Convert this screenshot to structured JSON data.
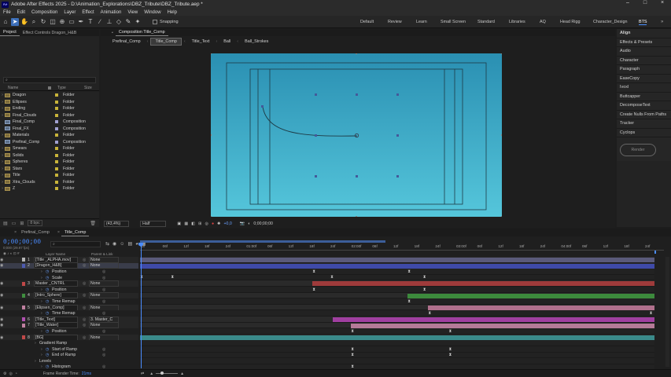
{
  "app": {
    "title": "Adobe After Effects 2025 - D:\\Animation_Explorations\\DBZ_Tribute\\DBZ_Tribute.aep *",
    "logo_text": "Ae"
  },
  "menu": [
    "File",
    "Edit",
    "Composition",
    "Layer",
    "Effect",
    "Animation",
    "View",
    "Window",
    "Help"
  ],
  "toolbar": {
    "snapping_label": "Snapping",
    "workspaces": [
      "Default",
      "Review",
      "Learn",
      "Small Screen",
      "Standard",
      "Libraries",
      "AQ",
      "Head Rigg",
      "Character_Design",
      "BTS"
    ],
    "active_workspace": "BTS"
  },
  "project_panel": {
    "tab_project": "Project",
    "tab_effect_controls": "Effect Controls Dragon_H&B",
    "search_placeholder": "",
    "col_name": "Name",
    "col_type": "Type",
    "col_size": "Size",
    "items": [
      {
        "name": "Dragon",
        "type": "Folder",
        "kind": "folder"
      },
      {
        "name": "Ellipses",
        "type": "Folder",
        "kind": "folder"
      },
      {
        "name": "Ending",
        "type": "Folder",
        "kind": "folder"
      },
      {
        "name": "Final_Clouds",
        "type": "Folder",
        "kind": "folder"
      },
      {
        "name": "Final_Comp",
        "type": "Composition",
        "kind": "comp"
      },
      {
        "name": "Final_FX",
        "type": "Composition",
        "kind": "comp"
      },
      {
        "name": "Materials",
        "type": "Folder",
        "kind": "folder"
      },
      {
        "name": "Prefinal_Comp",
        "type": "Composition",
        "kind": "comp"
      },
      {
        "name": "Smears",
        "type": "Folder",
        "kind": "folder"
      },
      {
        "name": "Solids",
        "type": "Folder",
        "kind": "folder"
      },
      {
        "name": "Spheres",
        "type": "Folder",
        "kind": "folder"
      },
      {
        "name": "Stars",
        "type": "Folder",
        "kind": "folder"
      },
      {
        "name": "Title",
        "type": "Folder",
        "kind": "folder"
      },
      {
        "name": "Xtra_Clouds",
        "type": "Folder",
        "kind": "folder"
      },
      {
        "name": "Z",
        "type": "Folder",
        "kind": "folder"
      }
    ],
    "bpc": "8 bpc"
  },
  "composition": {
    "panel_title": "Composition Title_Comp",
    "breadcrumbs": [
      "Prefinal_Comp",
      "Title_Comp",
      "Title_Text",
      "Ball",
      "Ball_Strokes"
    ],
    "active_breadcrumb": "Title_Comp",
    "zoom": "(43,4%)",
    "resolution": "Half",
    "plus_value": "+0,0",
    "timecode": "0;00;00;00",
    "bg_top": "#2a8fb2",
    "bg_bottom": "#55c6db"
  },
  "right_panel": {
    "items": [
      "Align",
      "Effects & Presets",
      "Audio",
      "Character",
      "Paragraph",
      "EaseCopy",
      "Ivoxl",
      "Buttcapper",
      "DecomposeText",
      "Create Nulls From Paths",
      "Tracker",
      "Cyclops"
    ],
    "render_button": "Render"
  },
  "timeline": {
    "tabs": [
      "Prefinal_Comp",
      "Title_Comp"
    ],
    "active_tab": "Title_Comp",
    "timecode": "0;00;00;00",
    "fps": "0;000 (29.97 fps)",
    "col_layer_name": "Layer Name",
    "col_parent": "Parent & Link",
    "ruler_labels": [
      "0f",
      "06f",
      "12f",
      "18f",
      "24f",
      "01:00f",
      "06f",
      "12f",
      "18f",
      "24f",
      "02:00f",
      "06f",
      "12f",
      "18f",
      "24f",
      "03:00f",
      "06f",
      "12f",
      "18f",
      "24f",
      "04:00f",
      "06f",
      "12f",
      "18f",
      "24f"
    ],
    "frame_render_label": "Frame Render Time:",
    "frame_render_value": "21ms",
    "rows": [
      {
        "num": "1",
        "name": "[Title _ALPHA.mov]",
        "parent": "None",
        "label": "#b5b5b5",
        "kind": "layer",
        "bar": "#5a5a7a",
        "bar_start": 0.0,
        "bar_end": 1.0,
        "keys": []
      },
      {
        "num": "2",
        "name": "[Dragon_H&B]",
        "parent": "None",
        "label": "#4e5bb0",
        "kind": "layer",
        "bar": "#3f4aa8",
        "bar_start": 0.0,
        "bar_end": 1.0,
        "keys": [],
        "selected": true
      },
      {
        "name": "Position",
        "kind": "prop",
        "keys": [
          0.335,
          0.52
        ]
      },
      {
        "name": "Scale",
        "kind": "prop",
        "keys": [
          0.0,
          0.06,
          0.37,
          0.55
        ]
      },
      {
        "num": "3",
        "name": "Master _CNTRL",
        "parent": "None",
        "label": "#c04848",
        "kind": "layer",
        "bar": "#9e3b3b",
        "bar_start": 0.335,
        "bar_end": 1.0,
        "keys": []
      },
      {
        "name": "Position",
        "kind": "prop",
        "keys": [
          0.335,
          0.55
        ]
      },
      {
        "num": "4",
        "name": "[Intro_Sphere]",
        "parent": "None",
        "label": "#3f8f3f",
        "kind": "layer",
        "bar": "#3c8a3c",
        "bar_start": 0.52,
        "bar_end": 1.0,
        "keys": []
      },
      {
        "name": "Time Remap",
        "kind": "prop",
        "keys": [
          0.52
        ]
      },
      {
        "num": "5",
        "name": "[Elipsen_Comp]",
        "parent": "None",
        "label": "#c080a0",
        "kind": "layer",
        "bar": "#b0708c",
        "bar_start": 0.56,
        "bar_end": 1.0,
        "keys": []
      },
      {
        "name": "Time Remap",
        "kind": "prop",
        "keys": [
          0.56,
          0.99
        ]
      },
      {
        "num": "6",
        "name": "[Title_Text]",
        "parent": "3. Master_C",
        "label": "#b050b0",
        "kind": "layer",
        "bar": "#a03fa0",
        "bar_start": 0.375,
        "bar_end": 1.0,
        "keys": []
      },
      {
        "num": "7",
        "name": "[Title_Water]",
        "parent": "None",
        "label": "#c080a0",
        "kind": "layer",
        "bar": "#b57a98",
        "bar_start": 0.41,
        "bar_end": 1.0,
        "keys": []
      },
      {
        "name": "Position",
        "kind": "prop",
        "keys": [
          0.41,
          0.6
        ]
      },
      {
        "num": "8",
        "name": "[BG]",
        "parent": "None",
        "label": "#c04848",
        "kind": "layer",
        "bar": "#3a8a8a",
        "bar_start": 0.0,
        "bar_end": 1.0,
        "keys": []
      },
      {
        "name": "Gradient Ramp",
        "kind": "group",
        "keys": []
      },
      {
        "name": "Start of Ramp",
        "kind": "prop",
        "keys": [
          0.41,
          0.6
        ]
      },
      {
        "name": "End of Ramp",
        "kind": "prop",
        "keys": [
          0.41,
          0.6
        ]
      },
      {
        "name": "Levels",
        "kind": "group",
        "keys": []
      },
      {
        "name": "Histogram",
        "kind": "prop",
        "keys": [
          0.41
        ]
      }
    ]
  }
}
